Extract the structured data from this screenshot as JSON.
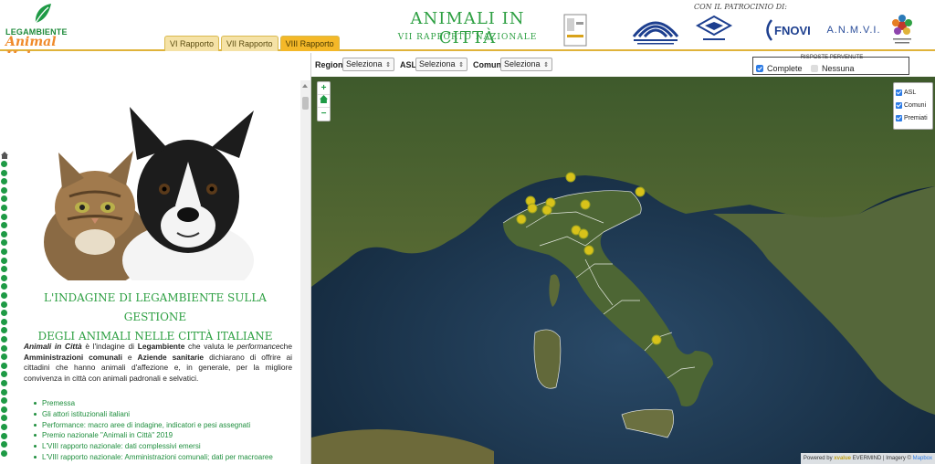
{
  "header": {
    "logo_main": "LEGAMBIENTE",
    "logo_sub": "Animal Help",
    "tabs": [
      "VI Rapporto",
      "VII Rapporto",
      "VIII Rapporto"
    ],
    "active_tab": "VIII Rapporto",
    "title": "ANIMALI IN CITTÀ",
    "subtitle": "VII RAPPORTO NAZIONALE",
    "patron_label": "CON IL PATROCINIO DI:",
    "patron_logos": [
      "FNOVI",
      "A.N.M.V.I."
    ]
  },
  "left_panel": {
    "heading_line1": "L'INDAGINE DI LEGAMBIENTE SULLA GESTIONE",
    "heading_line2": "DEGLI ANIMALI NELLE CITTÀ ITALIANE",
    "intro": {
      "p1": "Animali in Città",
      "p2": " è l'indagine di ",
      "p3": "Legambiente",
      "p4": " che valuta le ",
      "p5": "performance",
      "p6": "che ",
      "p7": "Amministrazioni comunali",
      "p8": " e ",
      "p9": "Aziende sanitarie",
      "p10": " dichiarano di offrire ai cittadini che hanno animali d'affezione e, in generale, per la migliore convivenza in città con animali padronali e selvatici."
    },
    "links": [
      "Premessa",
      "Gli attori istituzionali italiani",
      "Performance: macro aree di indagine, indicatori e pesi assegnati",
      "Premio nazionale \"Animali in Città\" 2019",
      "L'VIII rapporto nazionale: dati complessivi emersi",
      "L'VIII rapporto nazionale: Amministrazioni comunali; dati per macroaree"
    ]
  },
  "filters": {
    "regioni_label": "Regioni",
    "regioni_value": "Seleziona",
    "asl_label": "ASL",
    "asl_value": "Seleziona",
    "comuni_label": "Comuni",
    "comuni_value": "Seleziona",
    "risposte_title": "RISPOSTE PERVENUTE",
    "complete_label": "Complete",
    "complete_checked": true,
    "nessuna_label": "Nessuna",
    "nessuna_checked": false
  },
  "map": {
    "zoom_in": "+",
    "zoom_out": "−",
    "layers": [
      {
        "label": "ASL",
        "checked": true
      },
      {
        "label": "Comuni",
        "checked": true
      },
      {
        "label": "Premiati",
        "checked": true
      }
    ],
    "attribution_powered": "Powered by",
    "attribution_v": "xvalue",
    "attribution_e": "EVERMIND",
    "attribution_imagery": "| Imagery ©",
    "attribution_mapbox": "Mapbox",
    "colors": {
      "marker": "#d8c21a",
      "border": "#ffffff",
      "land": "#3d5a2a",
      "sea": "#1c3347"
    }
  }
}
